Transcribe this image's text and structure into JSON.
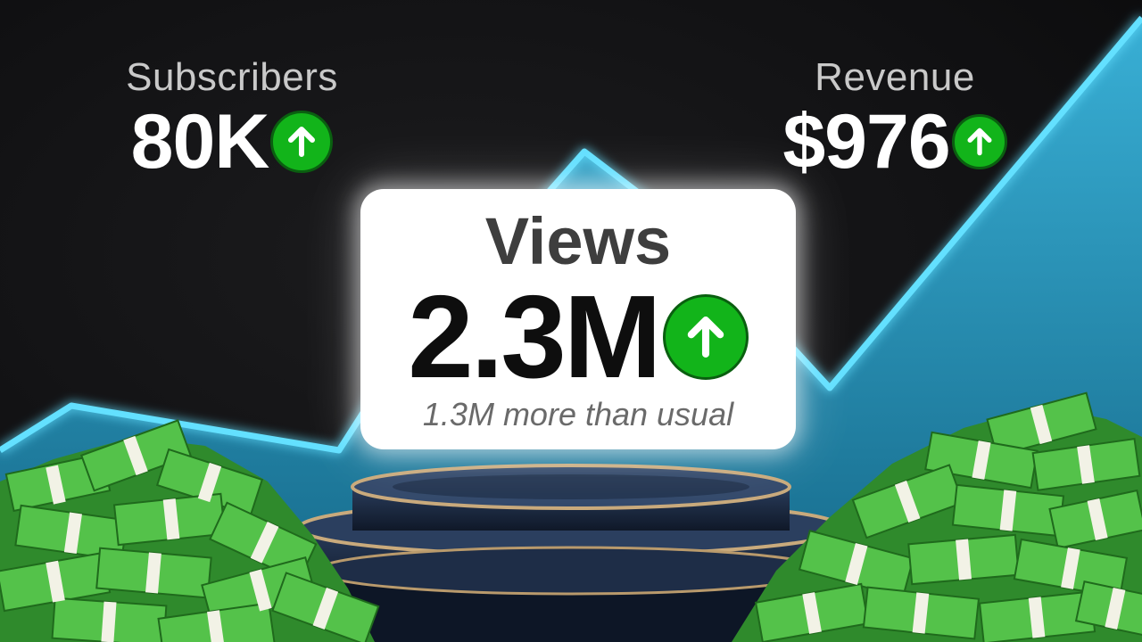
{
  "subscribers": {
    "label": "Subscribers",
    "value": "80K",
    "trend_icon": "arrow-up-icon"
  },
  "revenue": {
    "label": "Revenue",
    "value": "$976",
    "trend_icon": "arrow-up-icon"
  },
  "views": {
    "label": "Views",
    "value": "2.3M",
    "note": "1.3M more than usual",
    "trend_icon": "arrow-up-icon"
  },
  "colors": {
    "background": "#121214",
    "growth_line": "#4fd6ff",
    "growth_fill": "#1e8fb8",
    "badge": "#12b41a",
    "podium": "#1f2f4a",
    "podium_rim": "#c8a97a",
    "cash": "#3fae3a"
  }
}
